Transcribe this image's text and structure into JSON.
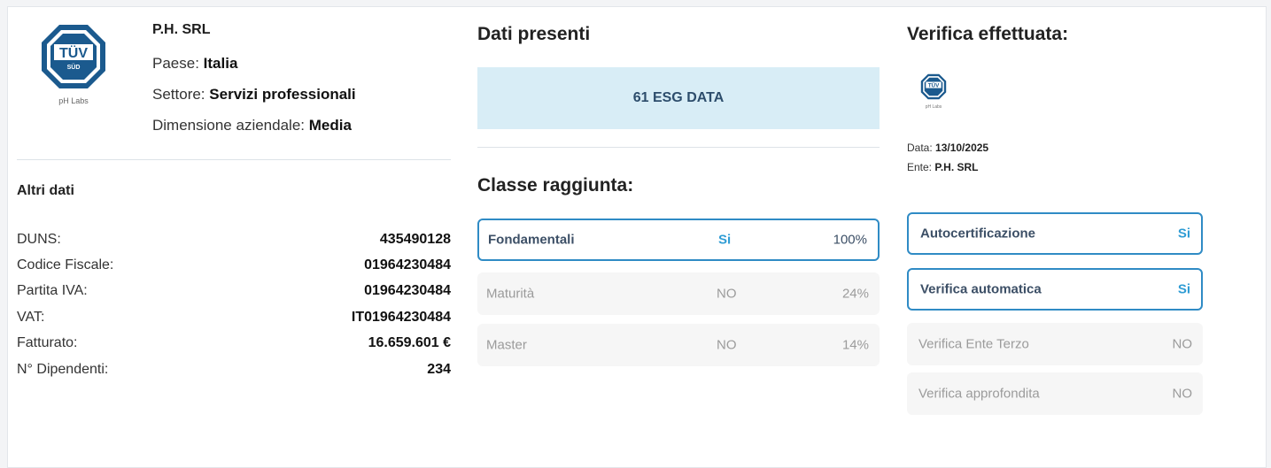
{
  "company": {
    "logo_caption": "pH Labs",
    "logo_text": "TÜV",
    "logo_subtext": "SÜD",
    "name": "P.H. SRL",
    "country_label": "Paese:",
    "country": "Italia",
    "sector_label": "Settore:",
    "sector": "Servizi professionali",
    "size_label": "Dimensione aziendale:",
    "size": "Media"
  },
  "altri_dati": {
    "title": "Altri dati",
    "rows": [
      {
        "key": "DUNS:",
        "value": "435490128"
      },
      {
        "key": "Codice Fiscale:",
        "value": "01964230484"
      },
      {
        "key": "Partita IVA:",
        "value": "01964230484"
      },
      {
        "key": "VAT:",
        "value": "IT01964230484"
      },
      {
        "key": "Fatturato:",
        "value": "16.659.601 €"
      },
      {
        "key": "N° Dipendenti:",
        "value": "234"
      }
    ]
  },
  "dati_presenti": {
    "title": "Dati presenti",
    "esg_label": "61 ESG DATA"
  },
  "classe": {
    "title": "Classe raggiunta:",
    "rows": [
      {
        "name": "Fondamentali",
        "status": "Si",
        "percent": "100%"
      },
      {
        "name": "Maturità",
        "status": "NO",
        "percent": "24%"
      },
      {
        "name": "Master",
        "status": "NO",
        "percent": "14%"
      }
    ]
  },
  "verifica": {
    "title": "Verifica effettuata:",
    "small_logo_caption": "pH Labs",
    "data_label": "Data:",
    "data_value": "13/10/2025",
    "ente_label": "Ente:",
    "ente_value": "P.H. SRL",
    "rows": [
      {
        "name": "Autocertificazione",
        "status": "Si"
      },
      {
        "name": "Verifica automatica",
        "status": "Si"
      },
      {
        "name": "Verifica Ente Terzo",
        "status": "NO"
      },
      {
        "name": "Verifica approfondita",
        "status": "NO"
      }
    ]
  },
  "colors": {
    "accent": "#2f8bc5",
    "status_yes": "#2f9cd4",
    "esg_bg": "#d8edf6",
    "logo_blue": "#1b5a8e"
  }
}
